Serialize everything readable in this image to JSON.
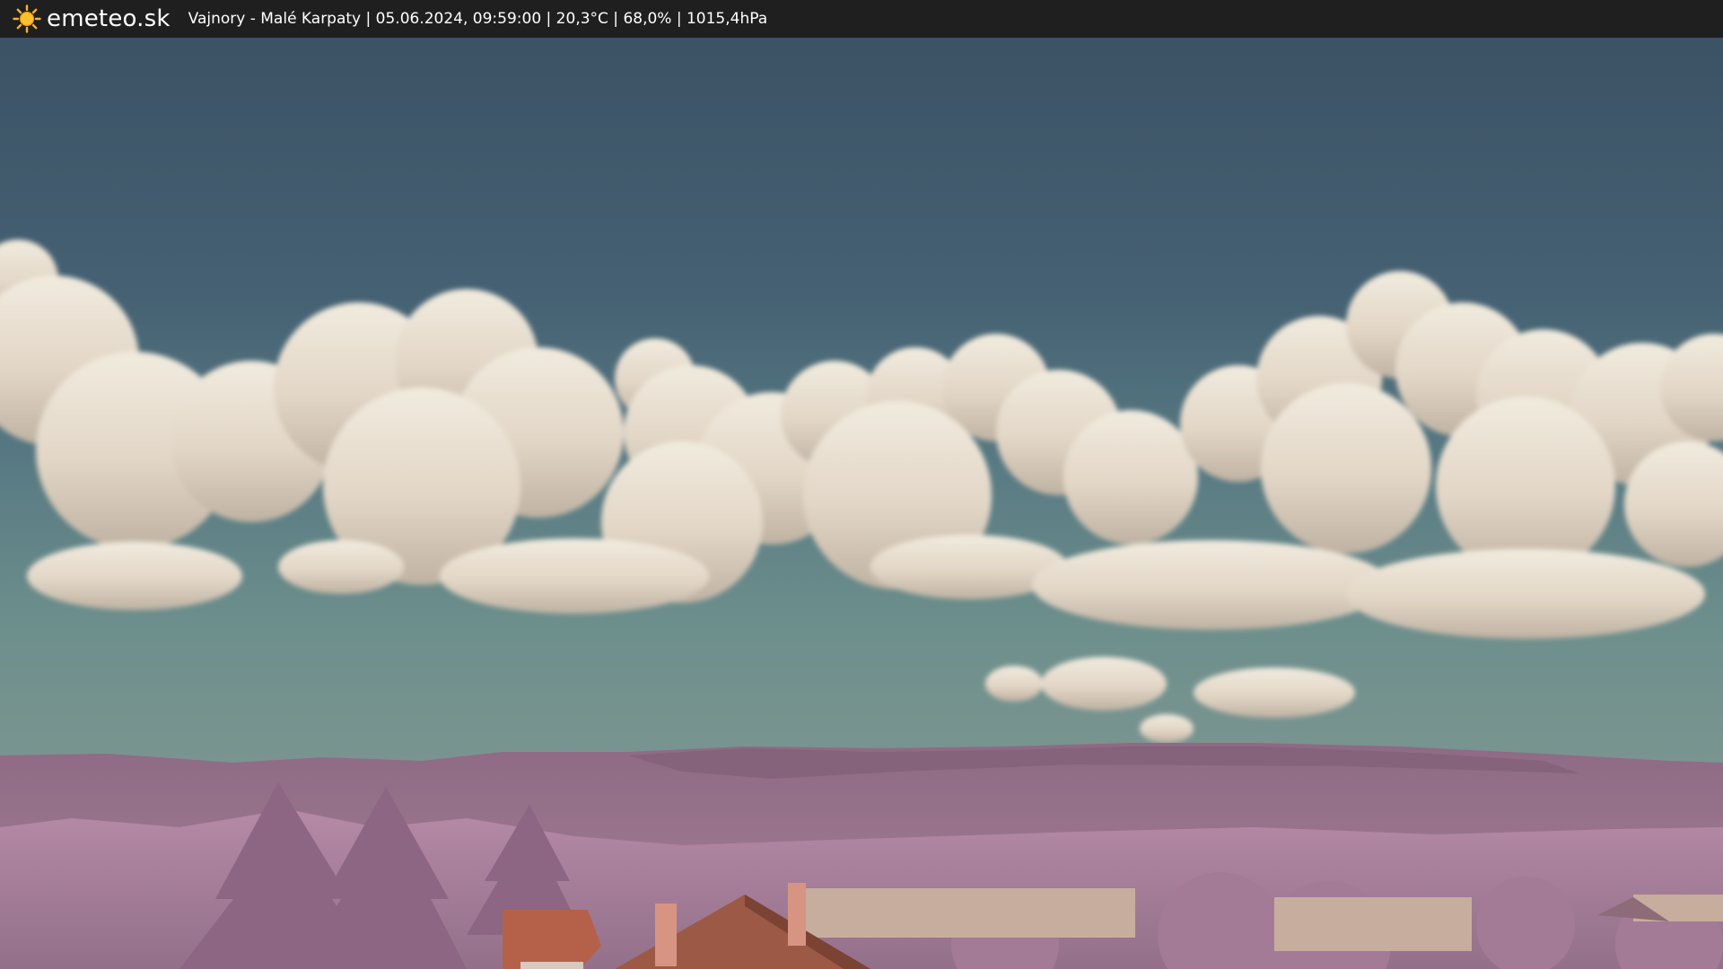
{
  "header": {
    "logo_text": "emeteo.sk",
    "logo_icon": "sun-icon",
    "status_line": "Vajnory - Malé Karpaty | 05.06.2024, 09:59:00 | 20,3°C | 68,0% | 1015,4hPa"
  },
  "colors": {
    "bar_background": "#1f1f1f",
    "sky_top": "#3f5568",
    "sky_horizon": "#6a8a8a",
    "cloud": "#e9e0d3",
    "foliage": "#a47a98",
    "roof": "#b5614a",
    "sun": "#f7b52c"
  }
}
